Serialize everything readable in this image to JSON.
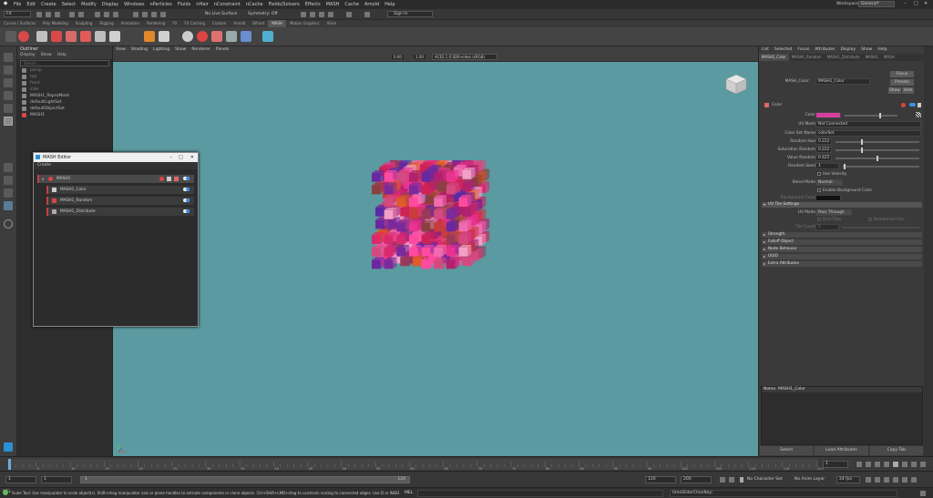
{
  "menubar": {
    "items": [
      "File",
      "Edit",
      "Create",
      "Select",
      "Modify",
      "Display",
      "Windows",
      "nParticles",
      "Fluids",
      "nHair",
      "nConstraint",
      "nCache",
      "Fields/Solvers",
      "Effects",
      "MASH",
      "Cache",
      "Arnold",
      "Help"
    ],
    "workspace_label": "Workspace :",
    "workspace_value": "General*"
  },
  "statusline": {
    "menuset": "FX",
    "live_surface": "No Live Surface",
    "symmetry": "Symmetry: Off",
    "sign_in": "Sign In"
  },
  "shelf": {
    "tabs": [
      "Curves / Surfaces",
      "Poly Modeling",
      "Sculpting",
      "Rigging",
      "Animation",
      "Rendering",
      "FX",
      "FX Caching",
      "Custom",
      "Arnold",
      "Bifrost",
      "MASH",
      "Motion Graphics",
      "XGen"
    ],
    "active_tab": "MASH"
  },
  "outliner": {
    "title": "Outliner",
    "menus": [
      "Display",
      "Show",
      "Help"
    ],
    "search_placeholder": "Search...",
    "items": [
      {
        "label": "persp",
        "dim": true
      },
      {
        "label": "top",
        "dim": true
      },
      {
        "label": "front",
        "dim": true
      },
      {
        "label": "side",
        "dim": true
      },
      {
        "label": "MASH1_ReproMesh",
        "dim": false
      },
      {
        "label": "defaultLightSet",
        "dim": false
      },
      {
        "label": "defaultObjectSet",
        "dim": false
      },
      {
        "label": "MASH1",
        "dim": false
      }
    ]
  },
  "viewport": {
    "menus": [
      "View",
      "Shading",
      "Lighting",
      "Show",
      "Renderer",
      "Panels"
    ],
    "exposure": "0.00",
    "gamma": "1.00",
    "color_space": "ACES 1.0 SDR-video (sRGB)",
    "camera_label": "persp",
    "background_color": "#5b9aa0"
  },
  "mash_editor": {
    "title": "MASH Editor",
    "menu": "Create",
    "nodes": [
      {
        "label": "MASH1",
        "level": 0
      },
      {
        "label": "MASH1_Color",
        "level": 1
      },
      {
        "label": "MASH1_Random",
        "level": 1
      },
      {
        "label": "MASH1_Distribute",
        "level": 1
      }
    ]
  },
  "attribute_editor": {
    "menus": [
      "List",
      "Selected",
      "Focus",
      "Attributes",
      "Display",
      "Show",
      "Help"
    ],
    "tabs": [
      "MASH1_Color",
      "MASH1_Random",
      "MASH1_Distribute",
      "MASH1",
      "MASH"
    ],
    "active_tab": "MASH1_Color",
    "node_type_label": "MASH_Color:",
    "node_name": "MASH1_Color",
    "focus_button": "Focus",
    "presets_button": "Presets",
    "show_button": "Show",
    "hide_button": "Hide",
    "section_color": "Color",
    "color_label": "Color",
    "color_swatch": "#d63fa0",
    "uv_mesh_label": "UV Mesh",
    "uv_mesh_value": "Not Connected",
    "color_set_label": "Color Set Name",
    "color_set_value": "colorSet",
    "random_hue_label": "Random Hue",
    "random_hue_value": "0.222",
    "sat_random_label": "Saturation Random",
    "sat_random_value": "0.222",
    "val_random_label": "Value Random",
    "val_random_value": "0.425",
    "seed_label": "Random Seed",
    "seed_value": "1",
    "use_velocity": "Use Velocity",
    "blend_mode_label": "Blend Mode",
    "blend_mode_value": "Normal",
    "enable_bg": "Enable Background Color",
    "bg_color_label": "Background Color",
    "uv_tile_section": "UV Tile Settings",
    "uv_mode_label": "UV Mode",
    "uv_mode_value": "Pass Through",
    "grid_tiles": "Grid Tiles",
    "randomize_uvs": "Randomize UVs",
    "tile_count_label": "Tile Count",
    "tile_count_value": "0",
    "collapsed_sections": [
      "Strength",
      "Falloff Object",
      "Node Behavior",
      "UUID",
      "Extra Attributes"
    ],
    "notes_label": "Notes:  MASH1_Color",
    "buttons": [
      "Select",
      "Load Attributes",
      "Copy Tab"
    ]
  },
  "timeslider": {
    "current_frame": "1",
    "ticks": [
      "5",
      "10",
      "15",
      "20",
      "25",
      "30",
      "35",
      "40",
      "45",
      "50",
      "55",
      "60",
      "65",
      "70",
      "75",
      "80",
      "85",
      "90",
      "95",
      "100",
      "105",
      "110",
      "115",
      "120"
    ],
    "frame_field": "1"
  },
  "rangeslider": {
    "start": "1",
    "start_inner": "1",
    "range_start_label": "1",
    "range_end_label": "120",
    "end_inner": "120",
    "end": "200",
    "character_set": "No Character Set",
    "anim_layer": "No Anim Layer",
    "fps": "24 fps"
  },
  "helpline": {
    "script_lang": "MEL",
    "help_text": "Scale Tool: Use manipulator to scale object(s). Shift+drag manipulator axis or plane handles to extrude components or clone objects. Ctrl+Shift+LMB+drag to constrain scaling to connected edges. Use D or INSERT to change the pivot p",
    "right_text": "timeSliderClearKey;"
  }
}
